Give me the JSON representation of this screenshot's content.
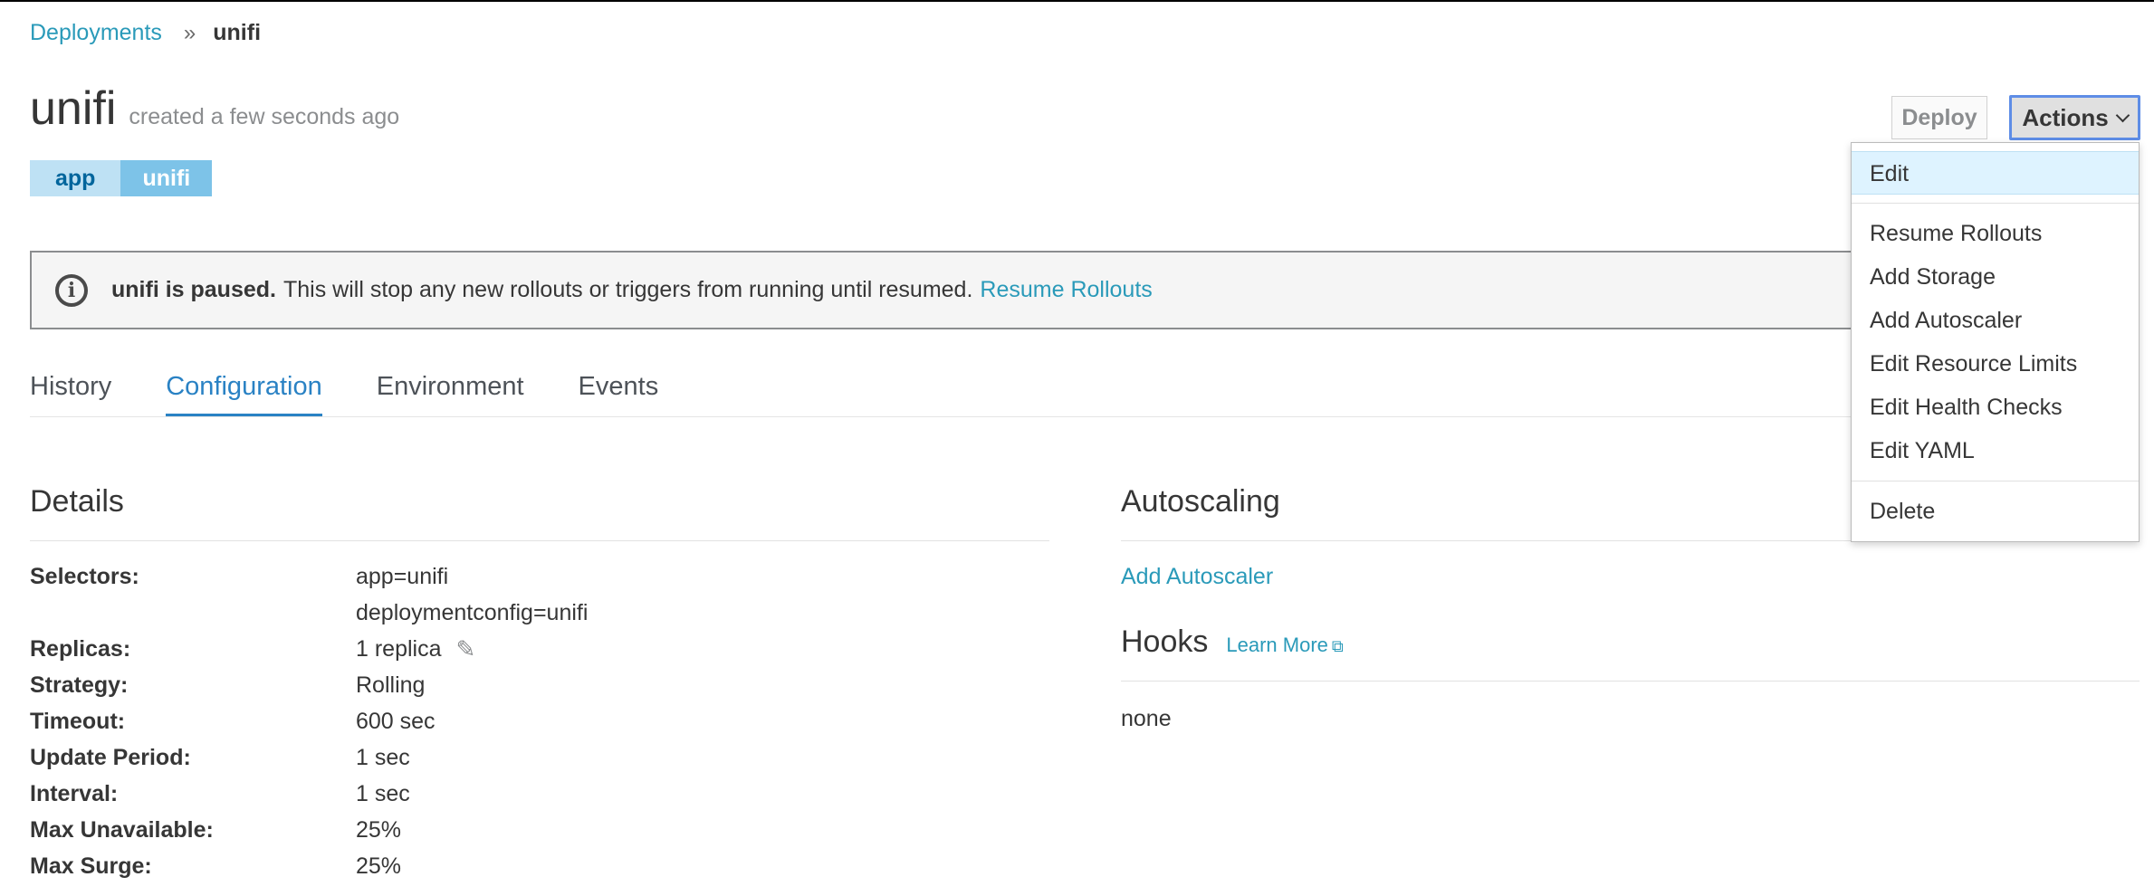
{
  "breadcrumb": {
    "parent": "Deployments",
    "separator": "»",
    "current": "unifi"
  },
  "header": {
    "title": "unifi",
    "subtitle": "created a few seconds ago"
  },
  "labels": [
    {
      "key": "app",
      "value": "unifi"
    }
  ],
  "top_actions": {
    "deploy_label": "Deploy",
    "actions_label": "Actions"
  },
  "actions_menu": {
    "items": [
      "Edit",
      "Resume Rollouts",
      "Add Storage",
      "Add Autoscaler",
      "Edit Resource Limits",
      "Edit Health Checks",
      "Edit YAML",
      "Delete"
    ],
    "active_item": "Edit"
  },
  "alert": {
    "icon": "info-icon",
    "strong": "unifi is paused.",
    "text": "This will stop any new rollouts or triggers from running until resumed.",
    "link": "Resume Rollouts"
  },
  "tabs": [
    "History",
    "Configuration",
    "Environment",
    "Events"
  ],
  "active_tab": "Configuration",
  "details": {
    "title": "Details",
    "rows": [
      {
        "key": "Selectors:",
        "value": "app=unifi"
      },
      {
        "key": "",
        "value": "deploymentconfig=unifi"
      },
      {
        "key": "Replicas:",
        "value": "1 replica"
      },
      {
        "key": "Strategy:",
        "value": "Rolling"
      },
      {
        "key": "Timeout:",
        "value": "600 sec"
      },
      {
        "key": "Update Period:",
        "value": "1 sec"
      },
      {
        "key": "Interval:",
        "value": "1 sec"
      },
      {
        "key": "Max Unavailable:",
        "value": "25%"
      },
      {
        "key": "Max Surge:",
        "value": "25%"
      }
    ]
  },
  "autoscaling": {
    "title": "Autoscaling",
    "link": "Add Autoscaler"
  },
  "hooks": {
    "title": "Hooks",
    "learn_more": "Learn More",
    "value": "none"
  },
  "colors": {
    "link": "#2a9ab9",
    "active_tab": "#2a82c4",
    "focus_border": "#5e8de6"
  }
}
